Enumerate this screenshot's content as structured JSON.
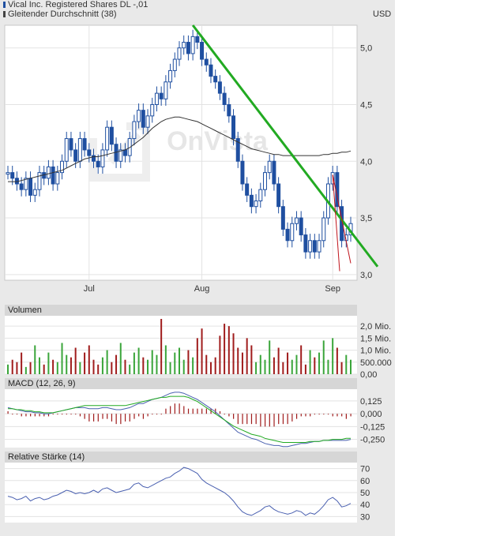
{
  "legend": [
    {
      "label": "Vical Inc. Registered Shares DL -,01",
      "color": "#1f4fa0"
    },
    {
      "label": "Gleitender Durchschnitt (38)",
      "color": "#444444"
    }
  ],
  "currency": "USD",
  "watermark": "OnVista",
  "colors": {
    "candle": "#1f4fa0",
    "ma": "#333333",
    "trend": "#22aa22",
    "channel": "#c0141c",
    "vol_up": "#3aa53a",
    "vol_down": "#a01c1c",
    "macd": "#4a60b0",
    "signal": "#22aa22",
    "rsi": "#4a60b0"
  },
  "chart_data": [
    {
      "type": "candlestick",
      "title": "",
      "xlabel": "",
      "ylabel": "",
      "x_ticks": [
        "Jul",
        "Aug",
        "Sep"
      ],
      "y_ticks": [
        "3,0",
        "3,5",
        "4,0",
        "4,5",
        "5,0"
      ],
      "ylim": [
        2.95,
        5.2
      ],
      "grid": true,
      "close": [
        3.9,
        3.85,
        3.8,
        3.75,
        3.85,
        3.7,
        3.75,
        3.9,
        3.85,
        3.95,
        3.8,
        3.9,
        4.0,
        4.2,
        4.1,
        4.0,
        4.2,
        4.1,
        4.05,
        4.0,
        3.95,
        4.1,
        4.3,
        4.15,
        4.0,
        4.1,
        4.05,
        4.2,
        4.35,
        4.45,
        4.3,
        4.4,
        4.5,
        4.6,
        4.55,
        4.7,
        4.8,
        4.9,
        5.0,
        5.05,
        4.95,
        5.1,
        5.05,
        4.9,
        4.85,
        4.75,
        4.7,
        4.6,
        4.5,
        4.4,
        4.2,
        4.0,
        3.8,
        3.7,
        3.6,
        3.65,
        3.75,
        3.9,
        4.0,
        3.8,
        3.6,
        3.4,
        3.3,
        3.45,
        3.5,
        3.35,
        3.2,
        3.3,
        3.2,
        3.3,
        3.5,
        3.8,
        3.9,
        3.6,
        3.3,
        3.35,
        3.45
      ],
      "moving_average_38": [
        3.82,
        3.82,
        3.82,
        3.83,
        3.84,
        3.85,
        3.86,
        3.87,
        3.88,
        3.89,
        3.9,
        3.91,
        3.92,
        3.94,
        3.96,
        3.98,
        4.0,
        4.02,
        4.03,
        4.04,
        4.04,
        4.05,
        4.06,
        4.07,
        4.08,
        4.09,
        4.1,
        4.12,
        4.15,
        4.18,
        4.21,
        4.25,
        4.29,
        4.32,
        4.35,
        4.37,
        4.38,
        4.39,
        4.39,
        4.38,
        4.37,
        4.36,
        4.35,
        4.33,
        4.31,
        4.29,
        4.27,
        4.25,
        4.23,
        4.21,
        4.19,
        4.17,
        4.15,
        4.13,
        4.11,
        4.1,
        4.09,
        4.08,
        4.07,
        4.06,
        4.06,
        4.05,
        4.05,
        4.05,
        4.05,
        4.05,
        4.05,
        4.05,
        4.05,
        4.05,
        4.06,
        4.06,
        4.07,
        4.07,
        4.08,
        4.08,
        4.09
      ],
      "annotations": [
        "green downward trend line",
        "red downward channel lines"
      ]
    },
    {
      "type": "bar",
      "title": "Volumen",
      "y_ticks": [
        "0,00",
        "500.000",
        "1,0 Mio.",
        "1,5 Mio.",
        "2,0 Mio."
      ],
      "ylim": [
        0,
        2300000
      ],
      "values": [
        0.4,
        0.6,
        0.5,
        0.9,
        0.3,
        0.5,
        1.2,
        0.7,
        0.4,
        0.9,
        0.6,
        0.5,
        1.3,
        0.8,
        0.7,
        1.1,
        0.5,
        0.9,
        1.2,
        0.6,
        0.4,
        0.7,
        1.0,
        0.5,
        0.8,
        1.3,
        0.6,
        0.4,
        0.9,
        1.1,
        0.7,
        0.6,
        1.0,
        0.8,
        2.3,
        1.2,
        0.5,
        0.9,
        1.1,
        0.6,
        1.0,
        0.7,
        1.5,
        1.9,
        0.8,
        0.5,
        0.7,
        1.6,
        2.1,
        2.0,
        1.7,
        1.1,
        0.9,
        1.5,
        1.2,
        0.5,
        0.8,
        0.6,
        1.4,
        0.7,
        1.1,
        0.5,
        0.9,
        0.6,
        0.8,
        1.2,
        0.4,
        1.0,
        0.7,
        0.9,
        1.4,
        0.6,
        1.5,
        1.1,
        0.5,
        0.8,
        0.6
      ]
    },
    {
      "type": "line",
      "title": "MACD (12, 26, 9)",
      "y_ticks": [
        "-0,250",
        "-0,125",
        "0,000",
        "0,125"
      ],
      "ylim": [
        -0.33,
        0.24
      ],
      "macd": [
        0.06,
        0.05,
        0.04,
        0.03,
        0.02,
        0.02,
        0.01,
        0.01,
        0.0,
        0.0,
        0.01,
        0.02,
        0.03,
        0.04,
        0.05,
        0.06,
        0.06,
        0.06,
        0.05,
        0.05,
        0.05,
        0.06,
        0.06,
        0.05,
        0.04,
        0.04,
        0.05,
        0.06,
        0.08,
        0.1,
        0.1,
        0.12,
        0.14,
        0.15,
        0.16,
        0.18,
        0.2,
        0.21,
        0.21,
        0.2,
        0.18,
        0.16,
        0.14,
        0.11,
        0.08,
        0.05,
        0.02,
        -0.02,
        -0.06,
        -0.1,
        -0.14,
        -0.18,
        -0.2,
        -0.22,
        -0.24,
        -0.25,
        -0.27,
        -0.29,
        -0.3,
        -0.31,
        -0.31,
        -0.32,
        -0.32,
        -0.31,
        -0.3,
        -0.29,
        -0.29,
        -0.28,
        -0.27,
        -0.27,
        -0.26,
        -0.26,
        -0.26,
        -0.26,
        -0.26,
        -0.26,
        -0.25
      ],
      "signal": [
        0.05,
        0.05,
        0.04,
        0.04,
        0.03,
        0.03,
        0.02,
        0.02,
        0.01,
        0.01,
        0.01,
        0.02,
        0.03,
        0.04,
        0.05,
        0.06,
        0.07,
        0.08,
        0.08,
        0.08,
        0.08,
        0.08,
        0.08,
        0.08,
        0.08,
        0.08,
        0.08,
        0.09,
        0.1,
        0.11,
        0.12,
        0.13,
        0.14,
        0.15,
        0.16,
        0.16,
        0.17,
        0.17,
        0.17,
        0.17,
        0.16,
        0.14,
        0.12,
        0.09,
        0.06,
        0.03,
        0.0,
        -0.03,
        -0.06,
        -0.09,
        -0.12,
        -0.14,
        -0.16,
        -0.18,
        -0.2,
        -0.21,
        -0.22,
        -0.24,
        -0.25,
        -0.26,
        -0.27,
        -0.28,
        -0.28,
        -0.28,
        -0.28,
        -0.28,
        -0.28,
        -0.27,
        -0.27,
        -0.27,
        -0.26,
        -0.26,
        -0.25,
        -0.25,
        -0.25,
        -0.24,
        -0.24
      ]
    },
    {
      "type": "line",
      "title": "Relative Stärke (14)",
      "y_ticks": [
        "30",
        "40",
        "50",
        "60",
        "70"
      ],
      "ylim": [
        25,
        75
      ],
      "values": [
        47,
        46,
        44,
        45,
        47,
        43,
        45,
        46,
        44,
        45,
        47,
        48,
        50,
        52,
        51,
        49,
        50,
        49,
        50,
        52,
        50,
        53,
        54,
        52,
        50,
        51,
        52,
        53,
        57,
        58,
        55,
        54,
        56,
        58,
        60,
        62,
        63,
        66,
        68,
        71,
        70,
        68,
        66,
        61,
        58,
        56,
        54,
        52,
        50,
        47,
        43,
        38,
        34,
        32,
        31,
        33,
        35,
        38,
        39,
        36,
        34,
        33,
        32,
        33,
        35,
        34,
        31,
        33,
        32,
        35,
        39,
        44,
        46,
        43,
        38,
        39,
        41
      ]
    }
  ]
}
